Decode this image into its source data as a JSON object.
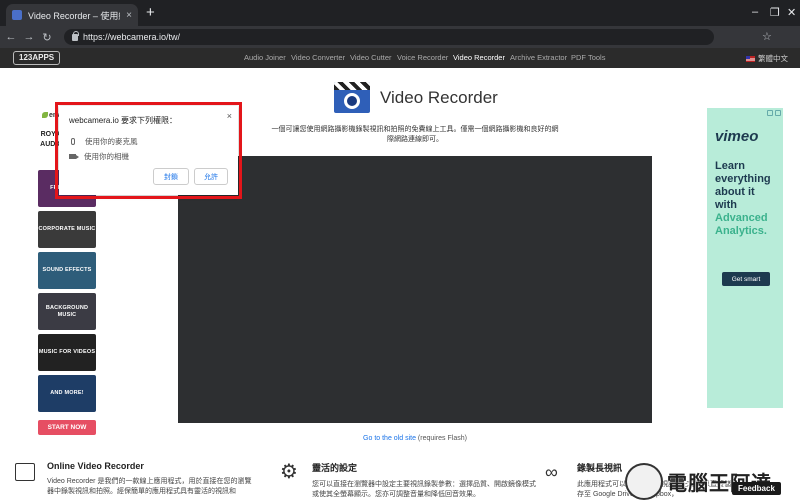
{
  "browser": {
    "tab_title": "Video Recorder – 使用網路攝影",
    "tab_close": "×",
    "new_tab": "+",
    "url": "https://webcamera.io/tw/"
  },
  "site_nav": {
    "logo": "123APPS",
    "items": [
      "Audio Joiner",
      "Video Converter",
      "Video Cutter",
      "Voice Recorder",
      "Video Recorder",
      "Archive Extractor",
      "PDF Tools"
    ],
    "active": "Video Recorder",
    "language": "繁體中文"
  },
  "permission_dialog": {
    "title": "webcamera.io 要求下列權限：",
    "close": "×",
    "mic": "使用你的麥克風",
    "camera": "使用你的相機",
    "block": "封鎖",
    "allow": "允許"
  },
  "left_ad": {
    "brand": "envato",
    "headline": "ROYALTY FREE AUDIO TRACKS",
    "tiles": [
      {
        "label": "FREE FILES",
        "color": "#5a2c62"
      },
      {
        "label": "CORPORATE MUSIC",
        "color": "#3a3a3a"
      },
      {
        "label": "SOUND EFFECTS",
        "color": "#2e5d7a"
      },
      {
        "label": "BACKGROUND MUSIC",
        "color": "#3b3b44"
      },
      {
        "label": "MUSIC FOR VIDEOS",
        "color": "#222"
      },
      {
        "label": "AND MORE!",
        "color": "#1e3d66"
      }
    ],
    "cta": "START NOW"
  },
  "main": {
    "title": "Video Recorder",
    "description": "一個可讓您使用網路攝影機錄製視訊和拍照的免費線上工具。僅需一個網路攝影機和良好的網際網路連線即可。",
    "old_site_link": "Go to the old site",
    "old_site_note": "(requires Flash)"
  },
  "right_ad": {
    "brand": "vimeo",
    "lines": [
      "Learn",
      "everything",
      "about it",
      "with",
      "Advanced",
      "Analytics."
    ],
    "cta": "Get smart",
    "accent": "#3bb28d"
  },
  "features": [
    {
      "title": "Online Video Recorder",
      "text": "Video Recorder 是我們的一款線上應用程式，用於直接在您的瀏覽器中錄製視訊和拍照。經保簡單的應用程式具有靈活的視訊和"
    },
    {
      "title": "靈活的設定",
      "text": "您可以直接在瀏覽器中設定主要視訊錄製參數：選擇品質、開啟鏡像模式或使其全螢幕顯示。您亦可調整音量和降低回音效果。"
    },
    {
      "title": "錄製長視訊",
      "text": "此應用程式可以錄製長時間視訊。它亦可以直接儲存至 Google Drive 或 Dropbox，"
    }
  ],
  "feedback": "Feedback",
  "watermark": "電腦王阿達"
}
